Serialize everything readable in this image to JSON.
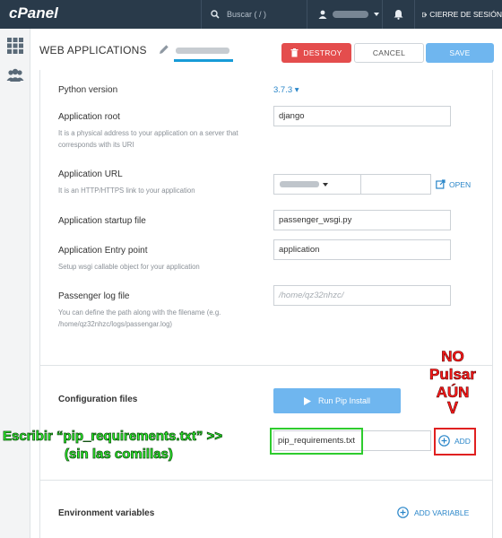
{
  "topbar": {
    "logo": "cPanel",
    "search_placeholder": "Buscar ( / )",
    "logout": "CIERRE DE SESIÓN"
  },
  "header": {
    "title": "WEB APPLICATIONS",
    "destroy": "DESTROY",
    "cancel": "CANCEL",
    "save": "SAVE"
  },
  "form": {
    "python_version_label": "Python version",
    "python_version_value": "3.7.3",
    "app_root_label": "Application root",
    "app_root_help": "It is a physical address to your application on a server that corresponds with its URI",
    "app_root_value": "django",
    "app_url_label": "Application URL",
    "app_url_help": "It is an HTTP/HTTPS link to your application",
    "open_label": "OPEN",
    "startup_label": "Application startup file",
    "startup_value": "passenger_wsgi.py",
    "entry_label": "Application Entry point",
    "entry_help": "Setup wsgi callable object for your application",
    "entry_value": "application",
    "log_label": "Passenger log file",
    "log_help": "You can define the path along with the filename (e.g. /home/qz32nhzc/logs/passengar.log)",
    "log_placeholder": "/home/qz32nhzc/"
  },
  "config": {
    "label": "Configuration files",
    "pip_button": "Run Pip Install",
    "file_value": "pip_requirements.txt",
    "add_label": "ADD"
  },
  "env": {
    "label": "Environment variables",
    "add_variable": "ADD VARIABLE"
  },
  "annotations": {
    "red_lines": [
      "NO",
      "Pulsar",
      "AÚN"
    ],
    "red_arrow": "V",
    "green_line1": "Escribir “pip_requirements.txt” >>",
    "green_line2": "(sin las comillas)"
  },
  "colors": {
    "topbar": "#293a4a",
    "accent": "#2a86c9",
    "destroy": "#e44d4d",
    "save": "#6fb6ef"
  }
}
